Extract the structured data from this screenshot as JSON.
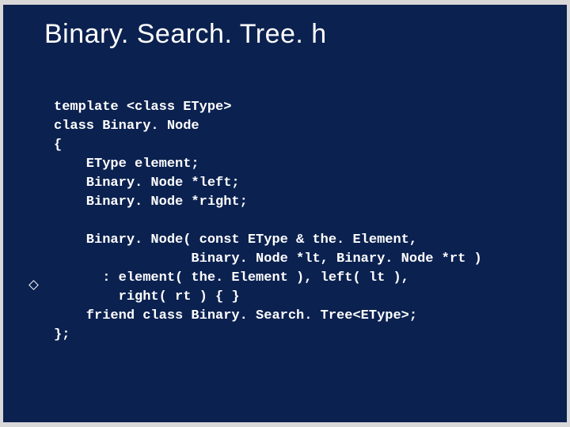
{
  "title": "Binary. Search. Tree. h",
  "code": {
    "l1": "template <class EType>",
    "l2": "class Binary. Node",
    "l3": "{",
    "l4": "    EType element;",
    "l5": "    Binary. Node *left;",
    "l6": "    Binary. Node *right;",
    "l7": "",
    "l8": "    Binary. Node( const EType & the. Element,",
    "l9": "                 Binary. Node *lt, Binary. Node *rt )",
    "l10": "      : element( the. Element ), left( lt ),",
    "l11": "        right( rt ) { }",
    "l12": "    friend class Binary. Search. Tree<EType>;",
    "l13": "};"
  }
}
